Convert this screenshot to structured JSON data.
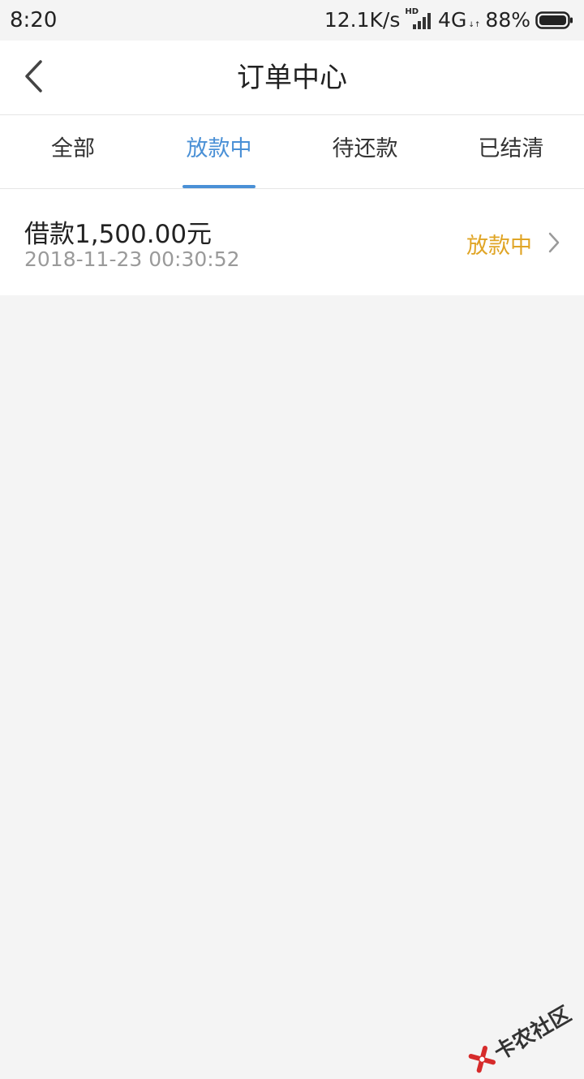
{
  "status_bar": {
    "time": "8:20",
    "net_speed": "12.1K/s",
    "hd": "HD",
    "network": "4G",
    "battery": "88%"
  },
  "header": {
    "title": "订单中心",
    "back_icon": "chevron-left-icon"
  },
  "tabs": [
    {
      "label": "全部",
      "active": false
    },
    {
      "label": "放款中",
      "active": true
    },
    {
      "label": "待还款",
      "active": false
    },
    {
      "label": "已结清",
      "active": false
    }
  ],
  "orders": [
    {
      "amount": "借款1,500.00元",
      "datetime": "2018-11-23 00:30:52",
      "status": "放款中"
    }
  ],
  "watermark": {
    "text": "卡农社区"
  },
  "colors": {
    "accent": "#4a90d6",
    "status": "#e0a526",
    "background": "#f4f4f4",
    "logo_red": "#d62b2b"
  }
}
